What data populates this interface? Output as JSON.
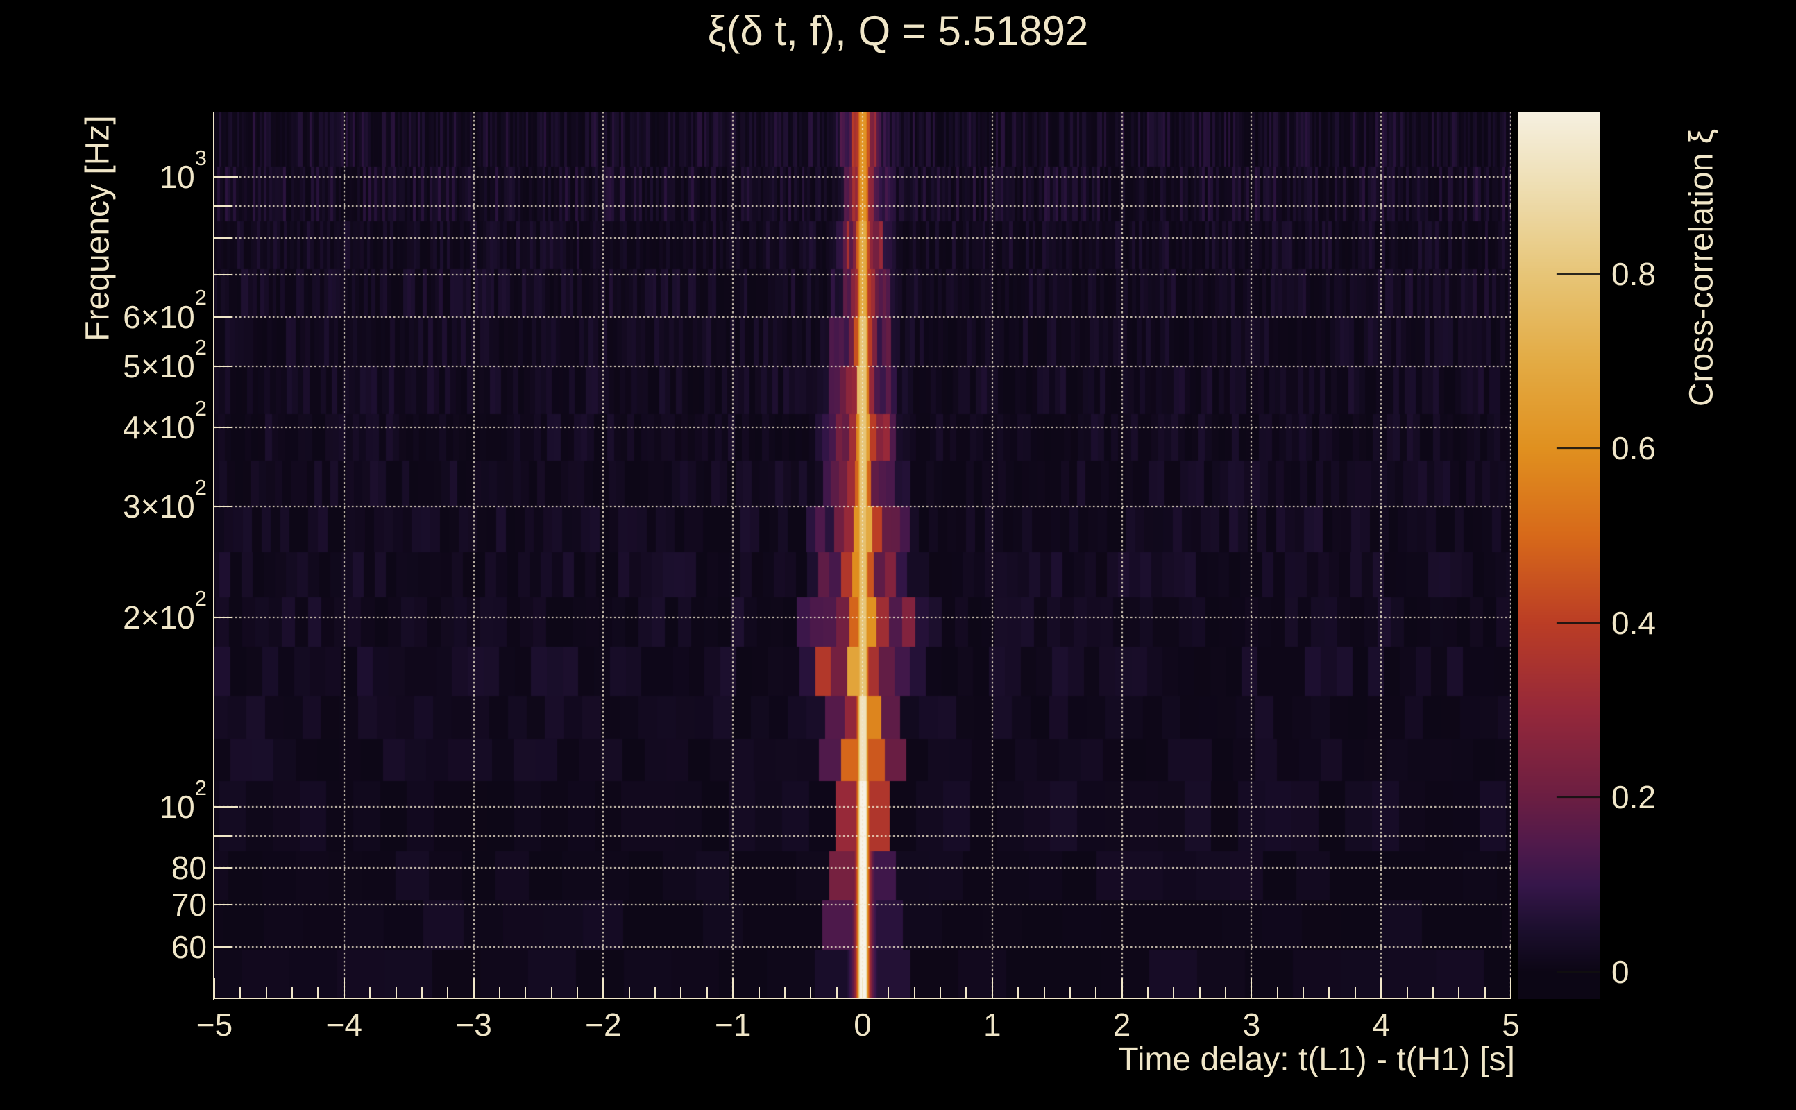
{
  "chart_data": {
    "type": "heatmap",
    "title": "ξ(δ t, f), Q = 5.51892",
    "xlabel": "Time delay: t(L1) - t(H1) [s]",
    "ylabel": "Frequency [Hz]",
    "zlabel": "Cross-correlation ξ",
    "q_value": 5.51892,
    "x_range_s": [
      -5,
      5
    ],
    "y_range_hz": [
      49.6,
      1269
    ],
    "y_scale": "log",
    "z_range": [
      -0.03,
      0.99
    ],
    "grid": {
      "style": "dotted",
      "color": "#f2e8ce",
      "on": true
    },
    "x_gridlines": [
      -4,
      -3,
      -2,
      -1,
      0,
      1,
      2,
      3,
      4,
      5
    ],
    "y_gridlines": [
      60,
      70,
      80,
      90,
      100,
      200,
      300,
      400,
      500,
      600,
      700,
      800,
      900,
      1000
    ],
    "x_minor_tick_step": 0.2,
    "x_ticks": [
      {
        "v": -5,
        "label": "−5"
      },
      {
        "v": -4,
        "label": "−4"
      },
      {
        "v": -3,
        "label": "−3"
      },
      {
        "v": -2,
        "label": "−2"
      },
      {
        "v": -1,
        "label": "−1"
      },
      {
        "v": 0,
        "label": "0"
      },
      {
        "v": 1,
        "label": "1"
      },
      {
        "v": 2,
        "label": "2"
      },
      {
        "v": 3,
        "label": "3"
      },
      {
        "v": 4,
        "label": "4"
      },
      {
        "v": 5,
        "label": "5"
      }
    ],
    "y_ticks": [
      {
        "v": 1000,
        "main": "10",
        "exp": "3"
      },
      {
        "v": 600,
        "main": "6×10",
        "exp": "2"
      },
      {
        "v": 500,
        "main": "5×10",
        "exp": "2"
      },
      {
        "v": 400,
        "main": "4×10",
        "exp": "2"
      },
      {
        "v": 300,
        "main": "3×10",
        "exp": "2"
      },
      {
        "v": 200,
        "main": "2×10",
        "exp": "2"
      },
      {
        "v": 100,
        "main": "10",
        "exp": "2"
      },
      {
        "v": 80,
        "main": "80",
        "exp": ""
      },
      {
        "v": 70,
        "main": "70",
        "exp": ""
      },
      {
        "v": 60,
        "main": "60",
        "exp": ""
      }
    ],
    "colorbar": {
      "top_value": 0.986,
      "bottom_value": -0.031,
      "ticks": [
        {
          "v": 0.8,
          "label": "0.8"
        },
        {
          "v": 0.6,
          "label": "0.6"
        },
        {
          "v": 0.4,
          "label": "0.4"
        },
        {
          "v": 0.2,
          "label": "0.2"
        },
        {
          "v": 0.0,
          "label": "0"
        }
      ]
    },
    "colormap_stops": [
      [
        0.0,
        "#0c0615"
      ],
      [
        0.05,
        "#1c0f2e"
      ],
      [
        0.1,
        "#36164a"
      ],
      [
        0.15,
        "#521a4b"
      ],
      [
        0.2,
        "#6b1e42"
      ],
      [
        0.3,
        "#95283a"
      ],
      [
        0.4,
        "#bb3d25"
      ],
      [
        0.5,
        "#d7691a"
      ],
      [
        0.6,
        "#e0901f"
      ],
      [
        0.7,
        "#e3ab44"
      ],
      [
        0.8,
        "#e7c577"
      ],
      [
        0.9,
        "#eedeb2"
      ],
      [
        1.0,
        "#f7f3e8"
      ]
    ],
    "ridge": {
      "time_delay_s": 0,
      "max_cross_correlation": 0.98,
      "description": "bright vertical ridge at zero time delay spanning 50-1270 Hz; white-hot core below ~110 Hz, orange core at mid and high frequencies, blocky purple/red correlation halo widest near 150-215 Hz"
    },
    "bands": [
      {
        "f_lo": 850,
        "f_hi": 1269,
        "halo_halfwidth_s": 0.24,
        "halo_amp": 0.13,
        "core_peak": 0.62,
        "noise_amp": 0.075
      },
      {
        "f_lo": 600,
        "f_hi": 850,
        "halo_halfwidth_s": 0.27,
        "halo_amp": 0.15,
        "core_peak": 0.7,
        "noise_amp": 0.055
      },
      {
        "f_lo": 420,
        "f_hi": 600,
        "halo_halfwidth_s": 0.3,
        "halo_amp": 0.18,
        "core_peak": 0.8,
        "noise_amp": 0.05
      },
      {
        "f_lo": 300,
        "f_hi": 420,
        "halo_halfwidth_s": 0.38,
        "halo_amp": 0.2,
        "core_peak": 0.8,
        "noise_amp": 0.045
      },
      {
        "f_lo": 215,
        "f_hi": 300,
        "halo_halfwidth_s": 0.42,
        "halo_amp": 0.24,
        "core_peak": 0.78,
        "noise_amp": 0.05
      },
      {
        "f_lo": 150,
        "f_hi": 215,
        "halo_halfwidth_s": 0.5,
        "halo_amp": 0.3,
        "core_peak": 0.8,
        "noise_amp": 0.05
      },
      {
        "f_lo": 110,
        "f_hi": 150,
        "halo_halfwidth_s": 0.34,
        "halo_amp": 0.26,
        "core_peak": 0.92,
        "noise_amp": 0.04
      },
      {
        "f_lo": 85,
        "f_hi": 110,
        "halo_halfwidth_s": 0.26,
        "halo_amp": 0.28,
        "core_peak": 1.0,
        "noise_amp": 0.035
      },
      {
        "f_lo": 49.6,
        "f_hi": 85,
        "halo_halfwidth_s": 0.2,
        "halo_amp": 0.3,
        "core_peak": 1.0,
        "noise_amp": 0.03
      }
    ],
    "seed": 13
  },
  "colors": {
    "background": "#000000",
    "text": "#f0e6c8",
    "axis": "#f0e6c8",
    "colorbar_tick": "#101010"
  }
}
